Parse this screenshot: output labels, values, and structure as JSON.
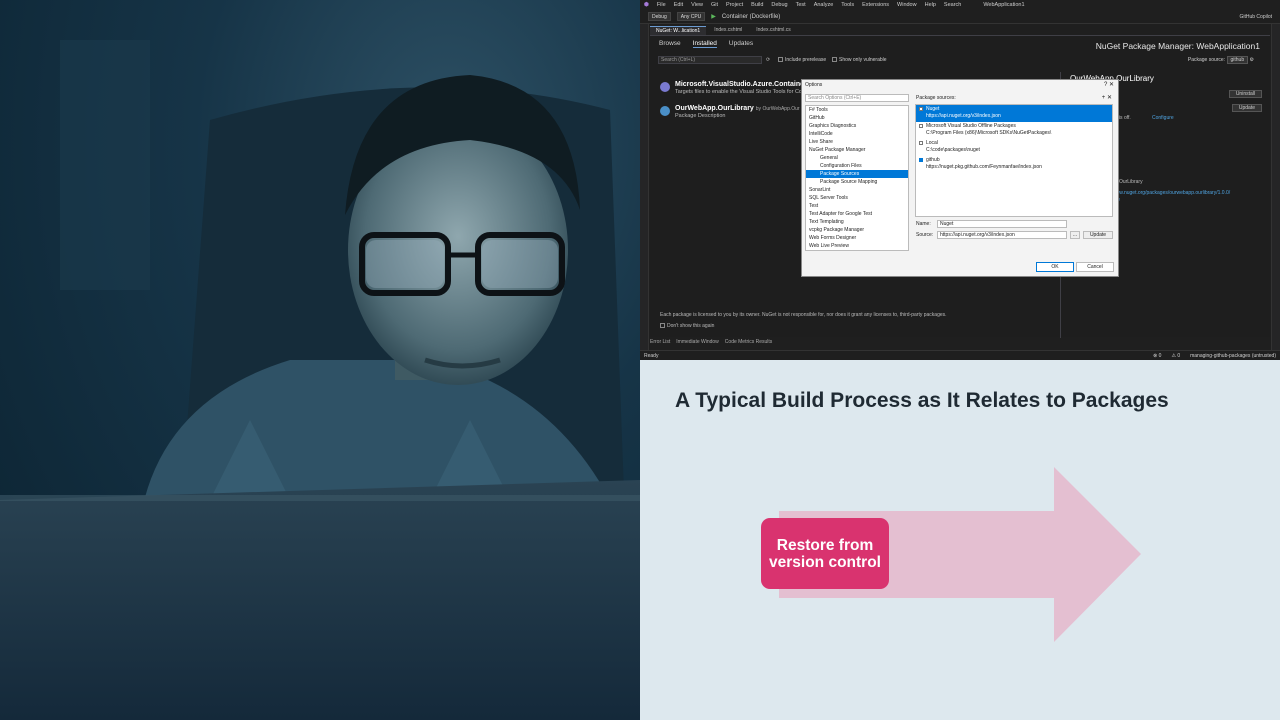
{
  "vs": {
    "menu": [
      "File",
      "Edit",
      "View",
      "Git",
      "Project",
      "Build",
      "Debug",
      "Test",
      "Analyze",
      "Tools",
      "Extensions",
      "Window",
      "Help"
    ],
    "search": "Search",
    "window_title": "WebApplication1",
    "toolbar": {
      "config": "Debug",
      "platform": "Any CPU",
      "run_target": "Container (Dockerfile)",
      "copilot": "GitHub Copilot"
    },
    "doc_tabs": [
      "NuGet: W...lication1",
      "Index.cshtml",
      "Index.cshtml.cs"
    ],
    "nuget": {
      "tabs": [
        "Browse",
        "Installed",
        "Updates"
      ],
      "active_tab": "Installed",
      "title": "NuGet Package Manager: WebApplication1",
      "search_placeholder": "Search (Ctrl+L)",
      "include_prerelease": "Include prerelease",
      "only_vulnerable": "Show only vulnerable",
      "source_label": "Package source:",
      "source_value": "github",
      "packages": [
        {
          "name": "Microsoft.VisualStudio.Azure.Containers",
          "desc": "Targets files to enable the Visual Studio Tools for Cont"
        },
        {
          "name": "OurWebApp.OurLibrary",
          "author": "by OurWebApp.Our",
          "desc": "Package Description"
        }
      ],
      "right_pkg": "OurWebApp.OurLibrary",
      "uninstall": "Uninstall",
      "update": "Update",
      "ing_off": "ng is off.",
      "configure": "Configure",
      "right_name": "pp.OurLibrary",
      "right_url": "www.nuget.org/packages/ourwebapp.ourlibrary/1.0.0/",
      "right_use": "use",
      "license": "Each package is licensed to you by its owner. NuGet is not responsible for, nor does it grant any licenses to, third-party packages.",
      "dont_show": "Don't show this again"
    },
    "bottom_tabs": [
      "Error List",
      "Immediate Window",
      "Code Metrics Results"
    ],
    "status": {
      "ready": "Ready",
      "errors": "0",
      "warnings": "0",
      "branch": "managing-github-packages (untrusted)"
    }
  },
  "dialog": {
    "title": "Options",
    "search_placeholder": "Search Options (Ctrl+E)",
    "tree": [
      {
        "label": "F# Tools",
        "level": 0
      },
      {
        "label": "GitHub",
        "level": 0
      },
      {
        "label": "Graphics Diagnostics",
        "level": 0
      },
      {
        "label": "IntelliCode",
        "level": 0
      },
      {
        "label": "Live Share",
        "level": 0
      },
      {
        "label": "NuGet Package Manager",
        "level": 0
      },
      {
        "label": "General",
        "level": 1
      },
      {
        "label": "Configuration Files",
        "level": 1
      },
      {
        "label": "Package Sources",
        "level": 1,
        "selected": true
      },
      {
        "label": "Package Source Mapping",
        "level": 1
      },
      {
        "label": "SonarLint",
        "level": 0
      },
      {
        "label": "SQL Server Tools",
        "level": 0
      },
      {
        "label": "Test",
        "level": 0
      },
      {
        "label": "Test Adapter for Google Test",
        "level": 0
      },
      {
        "label": "Text Templating",
        "level": 0
      },
      {
        "label": "vcpkg Package Manager",
        "level": 0
      },
      {
        "label": "Web Forms Designer",
        "level": 0
      },
      {
        "label": "Web Live Preview",
        "level": 0
      }
    ],
    "sources_label": "Package sources:",
    "sources": [
      {
        "name": "Nuget",
        "url": "https://api.nuget.org/v3/index.json",
        "checked": false,
        "selected": true
      },
      {
        "name": "Microsoft Visual Studio Offline Packages",
        "url": "C:\\Program Files (x86)\\Microsoft SDKs\\NuGetPackages\\",
        "checked": false,
        "selected": false
      },
      {
        "name": "Local",
        "url": "C:\\code\\packages\\nuget",
        "checked": false,
        "selected": false
      },
      {
        "name": "github",
        "url": "https://nuget.pkg.github.com/Feynmanfae/index.json",
        "checked": true,
        "selected": false
      }
    ],
    "name_label": "Name:",
    "name_value": "Nuget",
    "source_label": "Source:",
    "source_value": "https://api.nuget.org/v3/index.json",
    "browse": "...",
    "update": "Update",
    "ok": "OK",
    "cancel": "Cancel"
  },
  "slide": {
    "title": "A Typical Build Process as It Relates to Packages",
    "step": "Restore from version control",
    "colors": {
      "accent": "#d9336f",
      "arrow": "#e4bfd1",
      "background": "#dde8ee"
    }
  }
}
